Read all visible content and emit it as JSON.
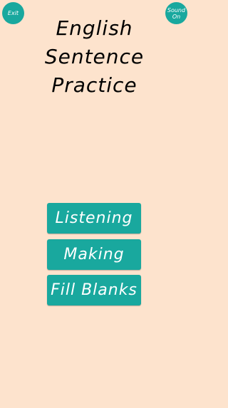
{
  "topbar": {
    "exit_label": "Exit",
    "sound_label_line1": "Sound",
    "sound_label_line2": "On"
  },
  "title": {
    "line1": "English",
    "line2": "Sentence",
    "line3": "Practice"
  },
  "menu": {
    "listening": "Listening",
    "making": "Making",
    "fill_blanks": "Fill Blanks"
  },
  "colors": {
    "background": "#fde3cd",
    "accent": "#19a89e",
    "text_light": "#ffffff",
    "text_dark": "#000000"
  }
}
